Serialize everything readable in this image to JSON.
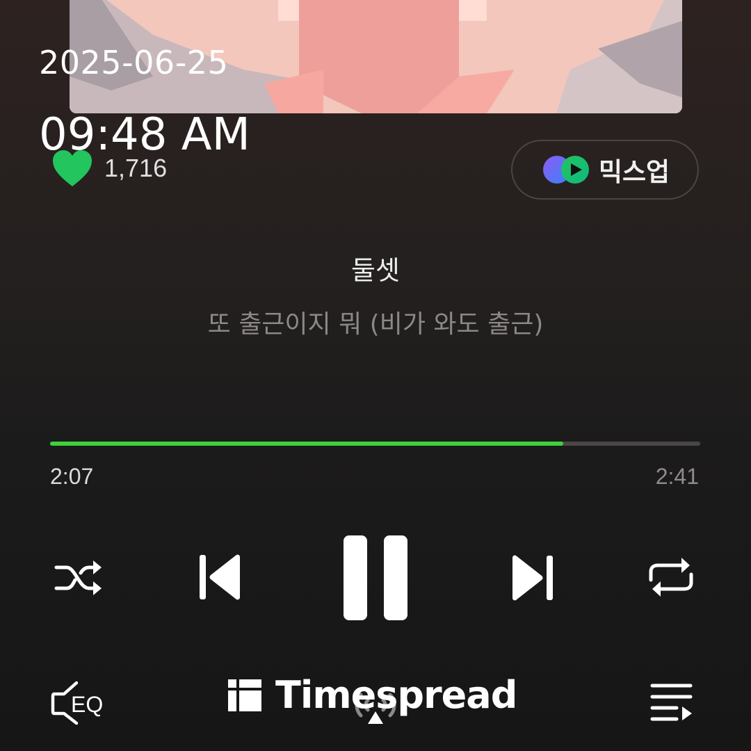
{
  "overlay": {
    "date": "2025-06-25",
    "time": "09:48 AM"
  },
  "track": {
    "like_count": "1,716",
    "artist": "둘셋",
    "title": "또 출근이지 뭐 (비가 와도 출근)"
  },
  "mixup": {
    "label": "믹스업"
  },
  "progress": {
    "current": "2:07",
    "total": "2:41",
    "fraction": 0.789
  },
  "bottom_bar": {
    "eq_label": "EQ"
  },
  "watermark": {
    "text": "Timespread"
  },
  "colors": {
    "accent_green": "#3cd23c",
    "heart_green": "#22c55e",
    "background": "#1c1b1b"
  },
  "icons": {
    "like": "heart-icon",
    "mixup": "mixup-logo-icon",
    "shuffle": "shuffle-icon",
    "previous": "skip-previous-icon",
    "pause": "pause-icon",
    "next": "skip-next-icon",
    "repeat": "repeat-icon",
    "eq": "eq-icon",
    "cast": "cast-icon",
    "playlist": "playlist-icon"
  }
}
